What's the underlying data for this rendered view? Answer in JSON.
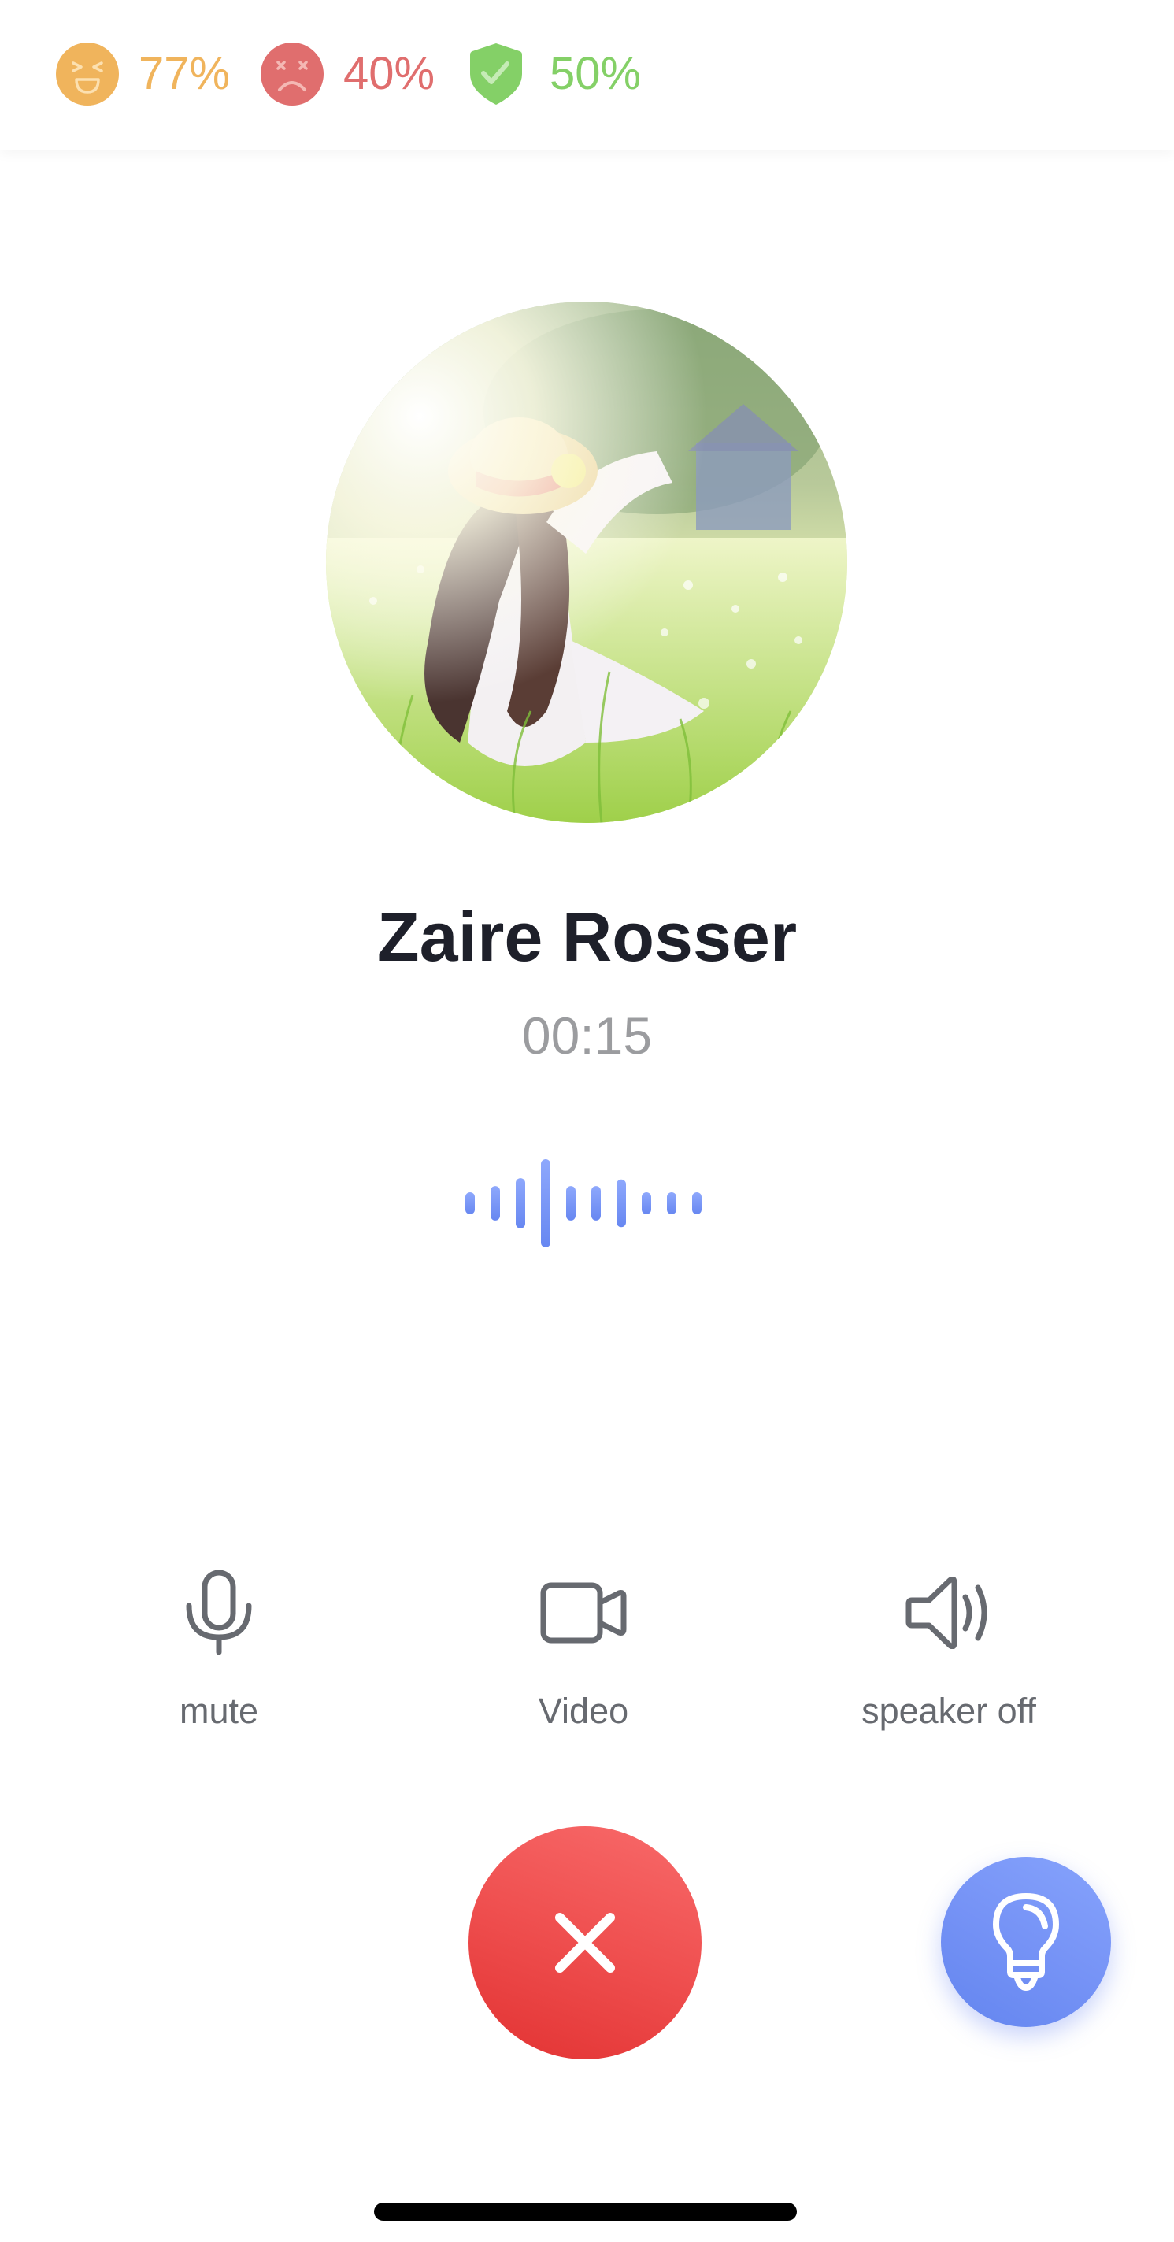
{
  "header": {
    "stats": [
      {
        "icon": "laughing-face-icon",
        "value": "77%",
        "color": "#F0B45C"
      },
      {
        "icon": "dizzy-sad-face-icon",
        "value": "40%",
        "color": "#E06E6E"
      },
      {
        "icon": "shield-check-icon",
        "value": "50%",
        "color": "#84D067"
      }
    ]
  },
  "call": {
    "avatar_icon": "contact-photo",
    "contact_name": "Zaire Rosser",
    "duration": "00:15",
    "waveform": {
      "icon": "voice-waveform-icon",
      "color": "#7393F5",
      "levels": [
        0.25,
        0.39,
        0.57,
        1.0,
        0.39,
        0.39,
        0.54,
        0.25,
        0.25,
        0.25
      ]
    }
  },
  "controls": [
    {
      "id": "mute",
      "icon": "microphone-icon",
      "label": "mute"
    },
    {
      "id": "video",
      "icon": "video-camera-icon",
      "label": "Video"
    },
    {
      "id": "speaker",
      "icon": "speaker-icon",
      "label": "speaker off"
    }
  ],
  "actions": {
    "end_call": {
      "icon": "close-icon",
      "color": "#EB4444"
    },
    "tips": {
      "icon": "lightbulb-icon",
      "color": "#7594F5"
    }
  },
  "colors": {
    "icon_gray": "#676A70",
    "name_text": "#1E202A",
    "timer_text": "#9B9C9F"
  }
}
